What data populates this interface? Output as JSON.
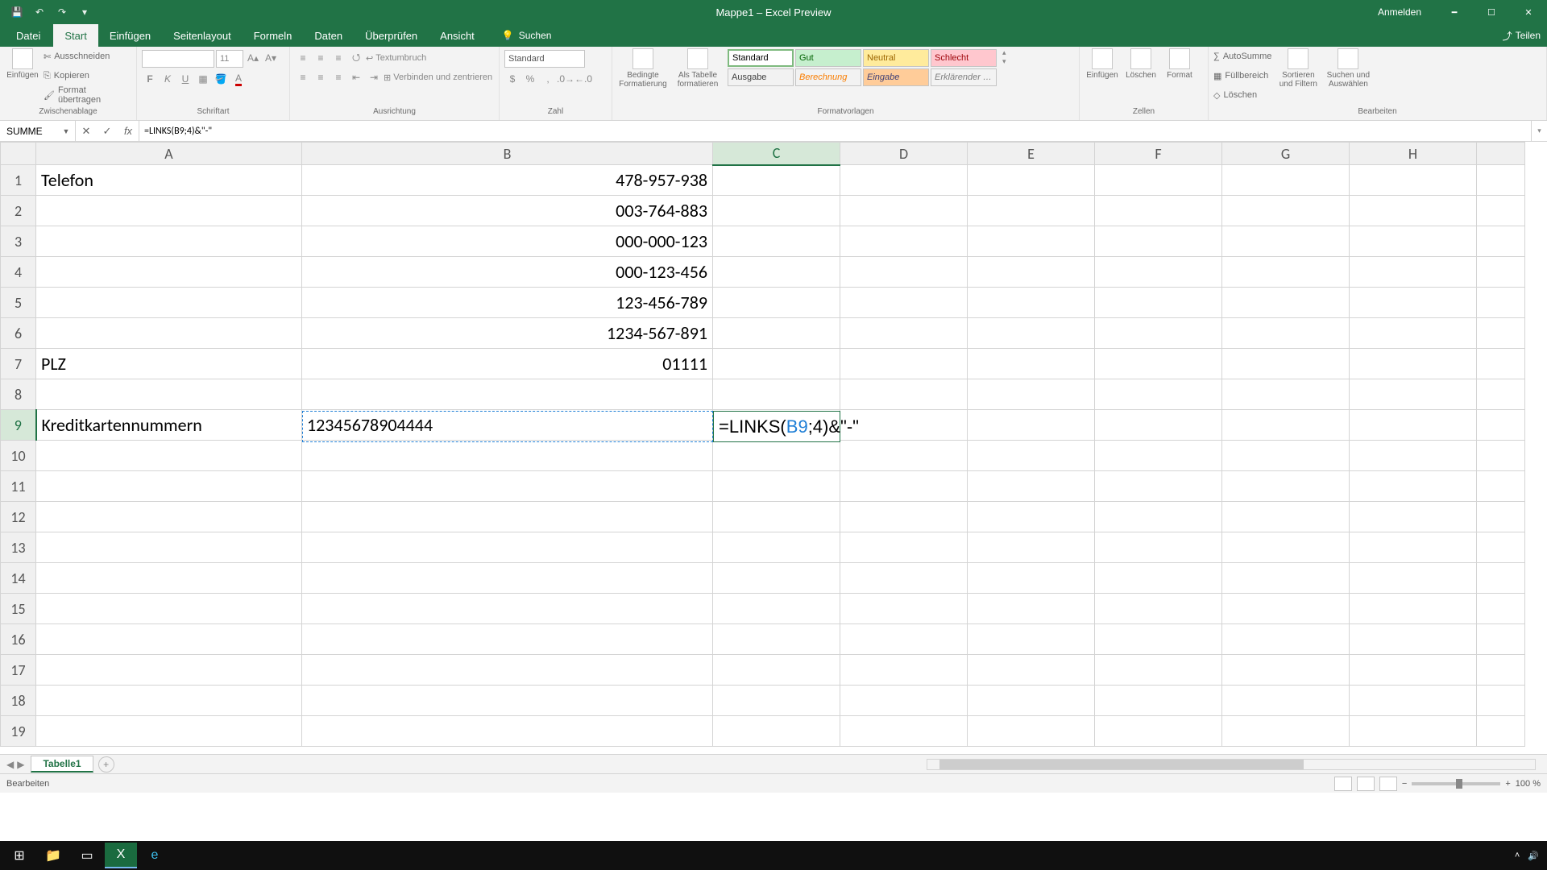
{
  "title": "Mappe1 – Excel Preview",
  "signin": "Anmelden",
  "tabs": {
    "file": "Datei",
    "home": "Start",
    "insert": "Einfügen",
    "layout": "Seitenlayout",
    "formulas": "Formeln",
    "data": "Daten",
    "review": "Überprüfen",
    "view": "Ansicht",
    "search": "Suchen",
    "share": "Teilen"
  },
  "ribbon": {
    "clipboard": {
      "paste": "Einfügen",
      "cut": "Ausschneiden",
      "copy": "Kopieren",
      "painter": "Format übertragen",
      "label": "Zwischenablage"
    },
    "font": {
      "name": "",
      "size": "11",
      "label": "Schriftart"
    },
    "align": {
      "wrap": "Textumbruch",
      "merge": "Verbinden und zentrieren",
      "label": "Ausrichtung"
    },
    "number": {
      "format": "Standard",
      "label": "Zahl"
    },
    "styles": {
      "cond": "Bedingte Formatierung",
      "table": "Als Tabelle formatieren",
      "s1": "Standard",
      "s2": "Gut",
      "s3": "Neutral",
      "s4": "Schlecht",
      "s5": "Ausgabe",
      "s6": "Berechnung",
      "s7": "Eingabe",
      "s8": "Erklärender …",
      "label": "Formatvorlagen"
    },
    "cells": {
      "insert": "Einfügen",
      "delete": "Löschen",
      "format": "Format",
      "label": "Zellen"
    },
    "editing": {
      "autosum": "AutoSumme",
      "fill": "Füllbereich",
      "clear": "Löschen",
      "sort": "Sortieren und Filtern",
      "find": "Suchen und Auswählen",
      "label": "Bearbeiten"
    }
  },
  "namebox": "SUMME",
  "formula": "=LINKS(B9;4)&\"-\"",
  "columns": [
    "A",
    "B",
    "C",
    "D",
    "E",
    "F",
    "G",
    "H"
  ],
  "cells": {
    "A1": "Telefon",
    "B1": "478-957-938",
    "B2": "003-764-883",
    "B3": "000-000-123",
    "B4": "000-123-456",
    "B5": "123-456-789",
    "B6": "1234-567-891",
    "A7": "PLZ",
    "B7": "01111",
    "A9": "Kreditkartennummern",
    "B9": "12345678904444"
  },
  "editcell": {
    "prefix": "=LINKS(",
    "ref": "B9",
    "suffix": ";4)&\"-\""
  },
  "sheet": "Tabelle1",
  "status": "Bearbeiten",
  "zoom": "100 %"
}
